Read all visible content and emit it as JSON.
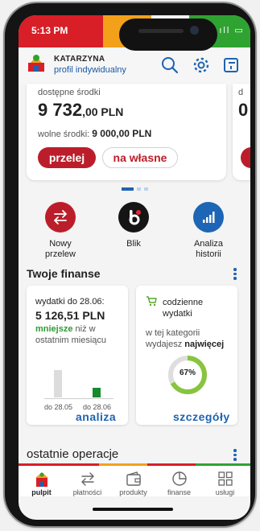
{
  "status_bar": {
    "time": "5:13 PM",
    "icons": "✱ ᯤ ıll ▭"
  },
  "header": {
    "user_name": "KATARZYNA",
    "profile_type": "profil indywidualny"
  },
  "account": {
    "available_label": "dostępne środki",
    "available_amount": "9 732",
    "available_decimals": ",00 PLN",
    "free_label": "wolne środki:",
    "free_amount": "9 000,00 PLN",
    "transfer_button": "przelej",
    "own_button": "na własne"
  },
  "account2": {
    "label": "d",
    "amount": "0"
  },
  "quick_actions": [
    {
      "label": "Nowy\nprzelew"
    },
    {
      "label": "Blik"
    },
    {
      "label": "Analiza\nhistorii"
    }
  ],
  "finances": {
    "title": "Twoje finanse",
    "card1": {
      "title": "wydatki do 28.06:",
      "amount": "5 126,51 PLN",
      "highlight": "mniejsze",
      "desc_rest": " niż w ostatnim miesiącu",
      "chart_labels": [
        "do 28.05",
        "do 28.06"
      ],
      "link": "analiza"
    },
    "card2": {
      "title": "codzienne wydatki",
      "desc_pre": "w tej kategorii wydajesz ",
      "desc_bold": "najwięcej",
      "percent": "67%",
      "percent_value": 67,
      "link": "szczegóły"
    }
  },
  "operations": {
    "title": "ostatnie operacje"
  },
  "nav": [
    {
      "label": "pulpit",
      "icon": "home-icon"
    },
    {
      "label": "płatności",
      "icon": "transfer-icon"
    },
    {
      "label": "produkty",
      "icon": "wallet-icon"
    },
    {
      "label": "finanse",
      "icon": "pie-chart-icon"
    },
    {
      "label": "usługi",
      "icon": "grid-icon"
    }
  ],
  "colors": {
    "brand_red": "#bb1e2a",
    "link_blue": "#1e63b0",
    "success_green": "#2e9a34",
    "blik_black": "#151515",
    "analysis_blue": "#1d66b5"
  }
}
